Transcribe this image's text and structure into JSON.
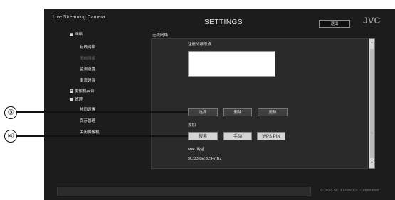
{
  "header": {
    "brand": "Live Streaming Camera",
    "title": "SETTINGS",
    "exit_label": "退出",
    "logo": "JVC"
  },
  "sidebar": {
    "items": [
      {
        "label": "网络",
        "expanded": true
      },
      {
        "label": "有线网络"
      },
      {
        "label": "无线网络",
        "disabled": true
      },
      {
        "label": "监测设置"
      },
      {
        "label": "串流设置"
      },
      {
        "label": "摄像机云台",
        "expanded": false
      },
      {
        "label": "管理",
        "expanded": true
      },
      {
        "label": "共同设置"
      },
      {
        "label": "保存管理"
      },
      {
        "label": "关闭摄像机"
      }
    ]
  },
  "content": {
    "section_title": "无线网络",
    "registered_ap_label": "注册的存取点",
    "buttons_row1": [
      "选择",
      "删除",
      "更新"
    ],
    "add_label": "添加",
    "buttons_row2": [
      "搜索",
      "手动",
      "WPS PIN"
    ],
    "mac_label": "MAC地址",
    "mac_value": "5C:33:8E:B2:F7:B2"
  },
  "callouts": [
    "③",
    "④"
  ],
  "footer": {
    "copyright": "© 2012 JVC KENWOOD Corporation"
  }
}
